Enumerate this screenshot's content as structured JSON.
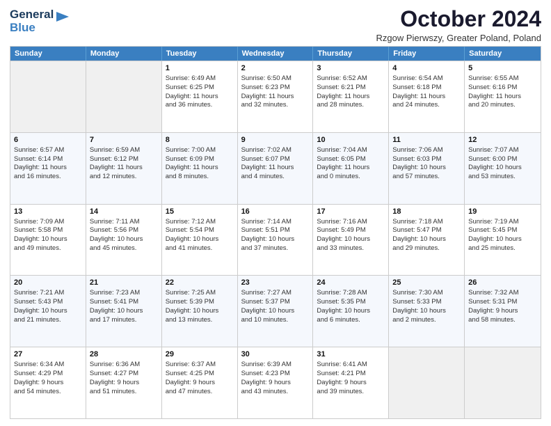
{
  "logo": {
    "line1": "General",
    "line2": "Blue",
    "icon": "▶"
  },
  "title": "October 2024",
  "location": "Rzgow Pierwszy, Greater Poland, Poland",
  "header": {
    "days": [
      "Sunday",
      "Monday",
      "Tuesday",
      "Wednesday",
      "Thursday",
      "Friday",
      "Saturday"
    ]
  },
  "rows": [
    [
      {
        "day": "",
        "empty": true
      },
      {
        "day": "",
        "empty": true
      },
      {
        "day": "1",
        "line1": "Sunrise: 6:49 AM",
        "line2": "Sunset: 6:25 PM",
        "line3": "Daylight: 11 hours",
        "line4": "and 36 minutes."
      },
      {
        "day": "2",
        "line1": "Sunrise: 6:50 AM",
        "line2": "Sunset: 6:23 PM",
        "line3": "Daylight: 11 hours",
        "line4": "and 32 minutes."
      },
      {
        "day": "3",
        "line1": "Sunrise: 6:52 AM",
        "line2": "Sunset: 6:21 PM",
        "line3": "Daylight: 11 hours",
        "line4": "and 28 minutes."
      },
      {
        "day": "4",
        "line1": "Sunrise: 6:54 AM",
        "line2": "Sunset: 6:18 PM",
        "line3": "Daylight: 11 hours",
        "line4": "and 24 minutes."
      },
      {
        "day": "5",
        "line1": "Sunrise: 6:55 AM",
        "line2": "Sunset: 6:16 PM",
        "line3": "Daylight: 11 hours",
        "line4": "and 20 minutes."
      }
    ],
    [
      {
        "day": "6",
        "line1": "Sunrise: 6:57 AM",
        "line2": "Sunset: 6:14 PM",
        "line3": "Daylight: 11 hours",
        "line4": "and 16 minutes."
      },
      {
        "day": "7",
        "line1": "Sunrise: 6:59 AM",
        "line2": "Sunset: 6:12 PM",
        "line3": "Daylight: 11 hours",
        "line4": "and 12 minutes."
      },
      {
        "day": "8",
        "line1": "Sunrise: 7:00 AM",
        "line2": "Sunset: 6:09 PM",
        "line3": "Daylight: 11 hours",
        "line4": "and 8 minutes."
      },
      {
        "day": "9",
        "line1": "Sunrise: 7:02 AM",
        "line2": "Sunset: 6:07 PM",
        "line3": "Daylight: 11 hours",
        "line4": "and 4 minutes."
      },
      {
        "day": "10",
        "line1": "Sunrise: 7:04 AM",
        "line2": "Sunset: 6:05 PM",
        "line3": "Daylight: 11 hours",
        "line4": "and 0 minutes."
      },
      {
        "day": "11",
        "line1": "Sunrise: 7:06 AM",
        "line2": "Sunset: 6:03 PM",
        "line3": "Daylight: 10 hours",
        "line4": "and 57 minutes."
      },
      {
        "day": "12",
        "line1": "Sunrise: 7:07 AM",
        "line2": "Sunset: 6:00 PM",
        "line3": "Daylight: 10 hours",
        "line4": "and 53 minutes."
      }
    ],
    [
      {
        "day": "13",
        "line1": "Sunrise: 7:09 AM",
        "line2": "Sunset: 5:58 PM",
        "line3": "Daylight: 10 hours",
        "line4": "and 49 minutes."
      },
      {
        "day": "14",
        "line1": "Sunrise: 7:11 AM",
        "line2": "Sunset: 5:56 PM",
        "line3": "Daylight: 10 hours",
        "line4": "and 45 minutes."
      },
      {
        "day": "15",
        "line1": "Sunrise: 7:12 AM",
        "line2": "Sunset: 5:54 PM",
        "line3": "Daylight: 10 hours",
        "line4": "and 41 minutes."
      },
      {
        "day": "16",
        "line1": "Sunrise: 7:14 AM",
        "line2": "Sunset: 5:51 PM",
        "line3": "Daylight: 10 hours",
        "line4": "and 37 minutes."
      },
      {
        "day": "17",
        "line1": "Sunrise: 7:16 AM",
        "line2": "Sunset: 5:49 PM",
        "line3": "Daylight: 10 hours",
        "line4": "and 33 minutes."
      },
      {
        "day": "18",
        "line1": "Sunrise: 7:18 AM",
        "line2": "Sunset: 5:47 PM",
        "line3": "Daylight: 10 hours",
        "line4": "and 29 minutes."
      },
      {
        "day": "19",
        "line1": "Sunrise: 7:19 AM",
        "line2": "Sunset: 5:45 PM",
        "line3": "Daylight: 10 hours",
        "line4": "and 25 minutes."
      }
    ],
    [
      {
        "day": "20",
        "line1": "Sunrise: 7:21 AM",
        "line2": "Sunset: 5:43 PM",
        "line3": "Daylight: 10 hours",
        "line4": "and 21 minutes."
      },
      {
        "day": "21",
        "line1": "Sunrise: 7:23 AM",
        "line2": "Sunset: 5:41 PM",
        "line3": "Daylight: 10 hours",
        "line4": "and 17 minutes."
      },
      {
        "day": "22",
        "line1": "Sunrise: 7:25 AM",
        "line2": "Sunset: 5:39 PM",
        "line3": "Daylight: 10 hours",
        "line4": "and 13 minutes."
      },
      {
        "day": "23",
        "line1": "Sunrise: 7:27 AM",
        "line2": "Sunset: 5:37 PM",
        "line3": "Daylight: 10 hours",
        "line4": "and 10 minutes."
      },
      {
        "day": "24",
        "line1": "Sunrise: 7:28 AM",
        "line2": "Sunset: 5:35 PM",
        "line3": "Daylight: 10 hours",
        "line4": "and 6 minutes."
      },
      {
        "day": "25",
        "line1": "Sunrise: 7:30 AM",
        "line2": "Sunset: 5:33 PM",
        "line3": "Daylight: 10 hours",
        "line4": "and 2 minutes."
      },
      {
        "day": "26",
        "line1": "Sunrise: 7:32 AM",
        "line2": "Sunset: 5:31 PM",
        "line3": "Daylight: 9 hours",
        "line4": "and 58 minutes."
      }
    ],
    [
      {
        "day": "27",
        "line1": "Sunrise: 6:34 AM",
        "line2": "Sunset: 4:29 PM",
        "line3": "Daylight: 9 hours",
        "line4": "and 54 minutes."
      },
      {
        "day": "28",
        "line1": "Sunrise: 6:36 AM",
        "line2": "Sunset: 4:27 PM",
        "line3": "Daylight: 9 hours",
        "line4": "and 51 minutes."
      },
      {
        "day": "29",
        "line1": "Sunrise: 6:37 AM",
        "line2": "Sunset: 4:25 PM",
        "line3": "Daylight: 9 hours",
        "line4": "and 47 minutes."
      },
      {
        "day": "30",
        "line1": "Sunrise: 6:39 AM",
        "line2": "Sunset: 4:23 PM",
        "line3": "Daylight: 9 hours",
        "line4": "and 43 minutes."
      },
      {
        "day": "31",
        "line1": "Sunrise: 6:41 AM",
        "line2": "Sunset: 4:21 PM",
        "line3": "Daylight: 9 hours",
        "line4": "and 39 minutes."
      },
      {
        "day": "",
        "empty": true
      },
      {
        "day": "",
        "empty": true
      }
    ]
  ]
}
